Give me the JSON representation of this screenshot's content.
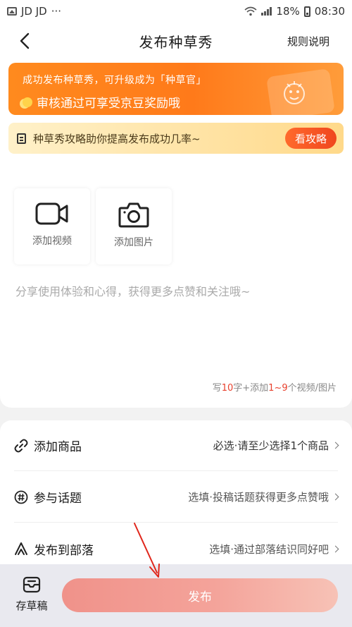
{
  "status_bar": {
    "carrier": "JD JD",
    "more": "···",
    "battery": "18%",
    "time": "08:30"
  },
  "header": {
    "title": "发布种草秀",
    "rules_label": "规则说明"
  },
  "promo": {
    "line1": "成功发布种草秀，可升级成为「种草官」",
    "line2": "审核通过可享受京豆奖励哦"
  },
  "tips": {
    "text": "种草秀攻略助你提高发布成功几率~",
    "button": "看攻略"
  },
  "media": {
    "video_label": "添加视频",
    "photo_label": "添加图片"
  },
  "content": {
    "placeholder": "分享使用体验和心得，获得更多点赞和关注哦~",
    "hint_prefix": "写",
    "hint_chars": "10",
    "hint_mid": "字+添加",
    "hint_range": "1~9",
    "hint_suffix": "个视频/图片"
  },
  "options": [
    {
      "label": "添加商品",
      "value": "必选·请至少选择1个商品"
    },
    {
      "label": "参与话题",
      "value": "选填·投稿话题获得更多点赞哦"
    },
    {
      "label": "发布到部落",
      "value": "选填·通过部落结识同好吧"
    }
  ],
  "footer": {
    "draft_label": "存草稿",
    "publish_label": "发布"
  },
  "colors": {
    "accent": "#ff7a1a",
    "highlight": "#e8402d",
    "publish": "#f4a39a"
  }
}
